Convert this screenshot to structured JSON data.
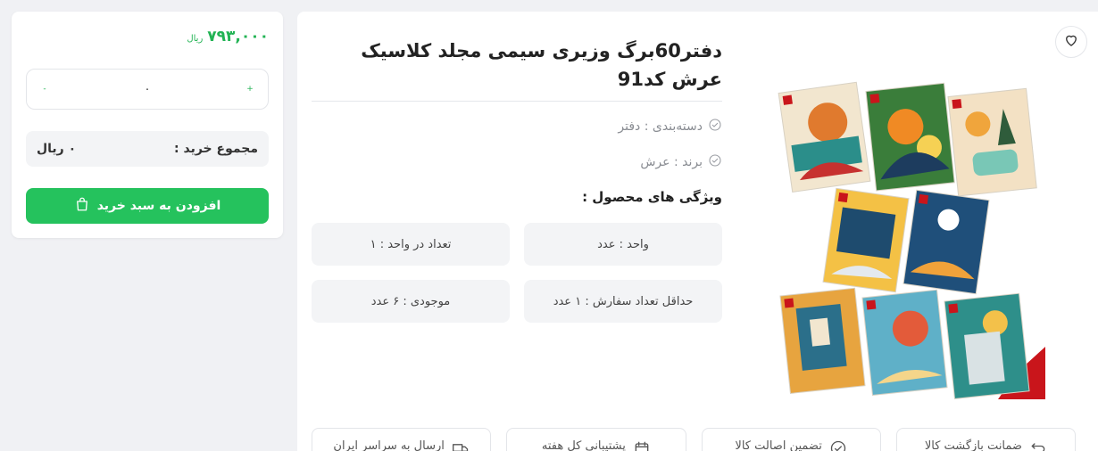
{
  "buy_box": {
    "price_amount": "۷۹۳,۰۰۰",
    "price_unit": "ریال",
    "qty_minus": "-",
    "qty_value": "۰",
    "qty_plus": "+",
    "total_label": "مجموع خرید :",
    "total_value": "۰ ریال",
    "add_to_cart_label": "افزودن به سبد خرید",
    "accent_color": "#25c25d"
  },
  "product": {
    "title": "دفتر60برگ وزیری سیمی مجلد کلاسیک عرش کد91",
    "category": "دسته‌بندی : دفتر",
    "brand": "برند : عرش",
    "features_title": "ویژگی های محصول :",
    "features": [
      "واحد : عدد",
      "تعداد در واحد : ۱",
      "حداقل تعداد سفارش : ۱ عدد",
      "موجودی : ۶ عدد"
    ],
    "guarantees": [
      {
        "icon": "return-icon",
        "label": "ضمانت بازگشت کالا"
      },
      {
        "icon": "check-badge-icon",
        "label": "تضمین اصالت کالا"
      },
      {
        "icon": "calendar-icon",
        "label": "پشتیبانی کل هفته"
      },
      {
        "icon": "truck-icon",
        "label": "ارسال به سراسر ایران"
      }
    ]
  }
}
